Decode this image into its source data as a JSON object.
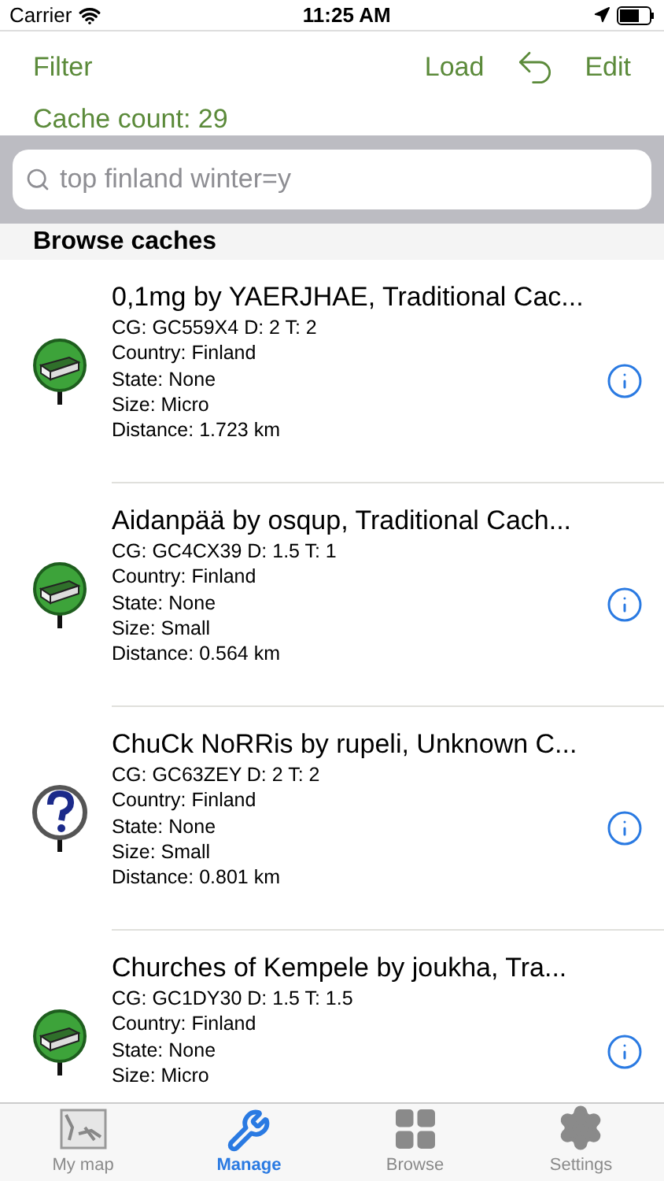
{
  "status_bar": {
    "carrier": "Carrier",
    "time": "11:25 AM"
  },
  "nav": {
    "filter": "Filter",
    "load": "Load",
    "edit": "Edit"
  },
  "cache_count": "Cache count: 29",
  "search": {
    "value": "top finland winter=y"
  },
  "section_title": "Browse caches",
  "caches": [
    {
      "kind": "traditional",
      "title": "0,1mg by YAERJHAE, Traditional Cac...",
      "details": [
        "CG: GC559X4 D: 2 T: 2",
        "Country: Finland",
        "State: None",
        "Size: Micro",
        "Distance: 1.723 km"
      ]
    },
    {
      "kind": "traditional",
      "title": "Aidanpää by osqup, Traditional Cach...",
      "details": [
        "CG: GC4CX39 D: 1.5 T: 1",
        "Country: Finland",
        "State: None",
        "Size: Small",
        "Distance: 0.564 km"
      ]
    },
    {
      "kind": "unknown",
      "title": "ChuCk NoRRis by rupeli, Unknown C...",
      "details": [
        "CG: GC63ZEY D: 2 T: 2",
        "Country: Finland",
        "State: None",
        "Size: Small",
        "Distance: 0.801 km"
      ]
    },
    {
      "kind": "traditional",
      "title": "Churches of Kempele by joukha, Tra...",
      "details": [
        "CG: GC1DY30 D: 1.5 T: 1.5",
        "Country: Finland",
        "State: None",
        "Size: Micro"
      ]
    }
  ],
  "tabs": [
    {
      "kind": "map",
      "label": "My map",
      "selected": false
    },
    {
      "kind": "wrench",
      "label": "Manage",
      "selected": true
    },
    {
      "kind": "grid",
      "label": "Browse",
      "selected": false
    },
    {
      "kind": "gear",
      "label": "Settings",
      "selected": false
    }
  ]
}
